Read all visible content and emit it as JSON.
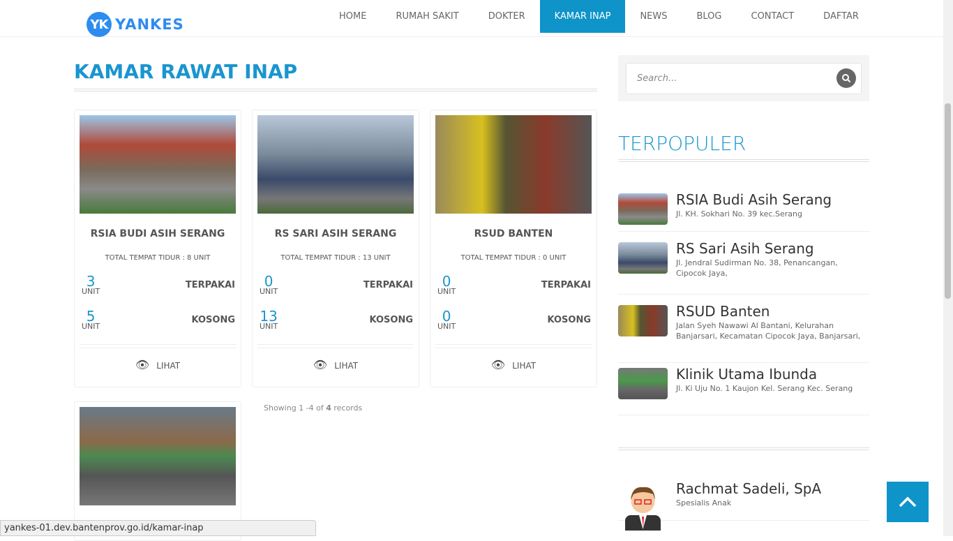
{
  "logo": {
    "mark": "YK",
    "text": "YANKES"
  },
  "nav": [
    "HOME",
    "RUMAH SAKIT",
    "DOKTER",
    "KAMAR INAP",
    "NEWS",
    "BLOG",
    "CONTACT",
    "DAFTAR"
  ],
  "page_title": "KAMAR RAWAT INAP",
  "cards": [
    {
      "name": "RSIA BUDI ASIH SERANG",
      "total": "TOTAL TEMPAT TIDUR : 8 UNIT",
      "used": "3",
      "empty": "5"
    },
    {
      "name": "RS SARI ASIH SERANG",
      "total": "TOTAL TEMPAT TIDUR : 13 UNIT",
      "used": "0",
      "empty": "13"
    },
    {
      "name": "RSUD BANTEN",
      "total": "TOTAL TEMPAT TIDUR : 0 UNIT",
      "used": "0",
      "empty": "0"
    }
  ],
  "labels": {
    "unit": "UNIT",
    "used": "TERPAKAI",
    "empty": "KOSONG",
    "view": "LIHAT"
  },
  "showing": {
    "prefix": "Showing 1 -4 of ",
    "count": "4",
    "suffix": " records"
  },
  "search": {
    "placeholder": "Search..."
  },
  "popular_title": "TERPOPULER",
  "popular": [
    {
      "name": "RSIA Budi Asih Serang",
      "addr": "Jl. KH. Sokhari No. 39 kec.Serang"
    },
    {
      "name": "RS Sari Asih Serang",
      "addr": "Jl. Jendral Sudirman No. 38, Penancangan, Cipocok Jaya,"
    },
    {
      "name": "RSUD Banten",
      "addr": "Jalan Syeh Nawawi Al Bantani, Kelurahan Banjarsari, Kecamatan Cipocok Jaya, Banjarsari,"
    },
    {
      "name": "Klinik Utama Ibunda",
      "addr": "Jl. Ki Uju No. 1 Kaujon Kel. Serang Kec. Serang"
    }
  ],
  "doctor": {
    "name": "Rachmat Sadeli, SpA",
    "spec": "Spesialis Anak"
  },
  "status_url": "yankes-01.dev.bantenprov.go.id/kamar-inap"
}
